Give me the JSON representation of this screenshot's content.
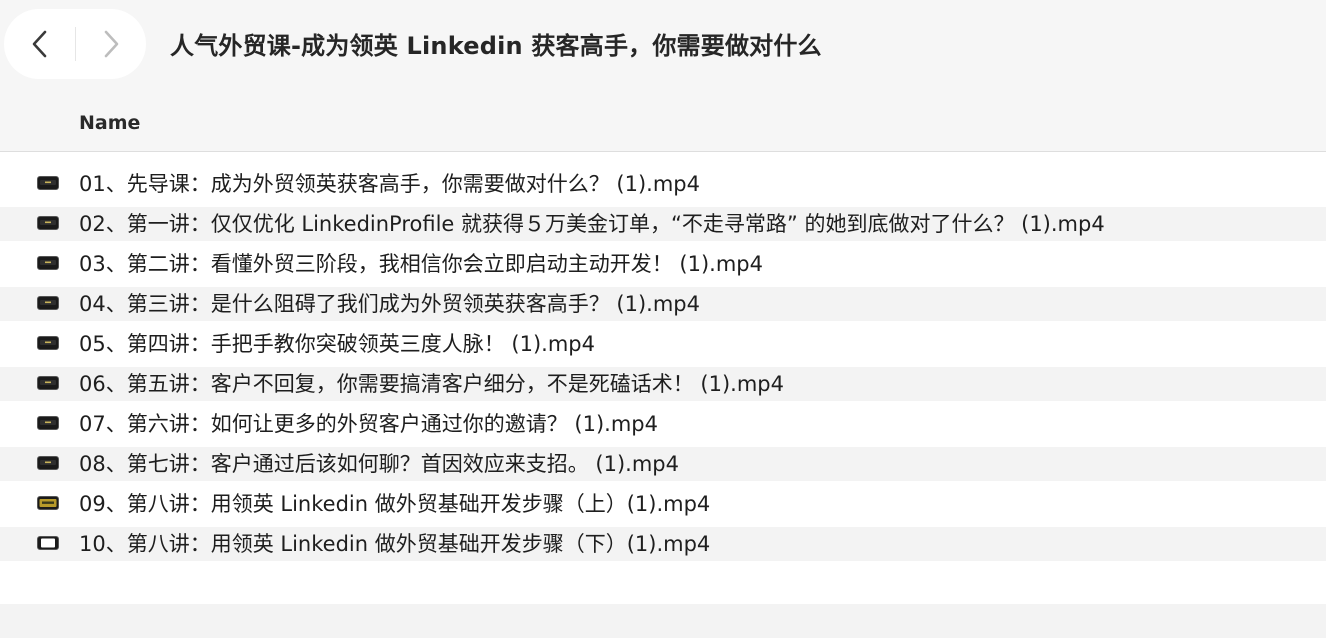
{
  "window": {
    "title": "人气外贸课-成为领英 Linkedin 获客高手，你需要做对什么"
  },
  "toolbar": {
    "back_icon": "chevron-left-icon",
    "forward_icon": "chevron-right-icon"
  },
  "list": {
    "column_name": "Name",
    "files": [
      {
        "name": "01、先导课：成为外贸领英获客高手，你需要做对什么？ (1).mp4",
        "icon": "video-file-icon"
      },
      {
        "name": "02、第一讲：仅仅优化 LinkedinProfile 就获得５万美金订单，“不走寻常路” 的她到底做对了什么？ (1).mp4",
        "icon": "video-file-icon"
      },
      {
        "name": "03、第二讲：看懂外贸三阶段，我相信你会立即启动主动开发！ (1).mp4",
        "icon": "video-file-icon"
      },
      {
        "name": "04、第三讲：是什么阻碍了我们成为外贸领英获客高手？ (1).mp4",
        "icon": "video-file-icon"
      },
      {
        "name": "05、第四讲：手把手教你突破领英三度人脉！ (1).mp4",
        "icon": "video-file-icon"
      },
      {
        "name": "06、第五讲：客户不回复，你需要搞清客户细分，不是死磕话术！ (1).mp4",
        "icon": "video-file-icon"
      },
      {
        "name": "07、第六讲：如何让更多的外贸客户通过你的邀请？ (1).mp4",
        "icon": "video-file-icon"
      },
      {
        "name": "08、第七讲：客户通过后该如何聊？首因效应来支招。 (1).mp4",
        "icon": "video-file-icon"
      },
      {
        "name": "09、第八讲：用领英 Linkedin 做外贸基础开发步骤（上）(1).mp4",
        "icon": "video-file-icon"
      },
      {
        "name": "10、第八讲：用领英 Linkedin 做外贸基础开发步骤（下）(1).mp4",
        "icon": "video-file-icon"
      }
    ]
  },
  "colors": {
    "chrome_bg": "#f6f6f6",
    "row_alt_bg": "#f3f3f3",
    "text": "#1e1e1e"
  }
}
